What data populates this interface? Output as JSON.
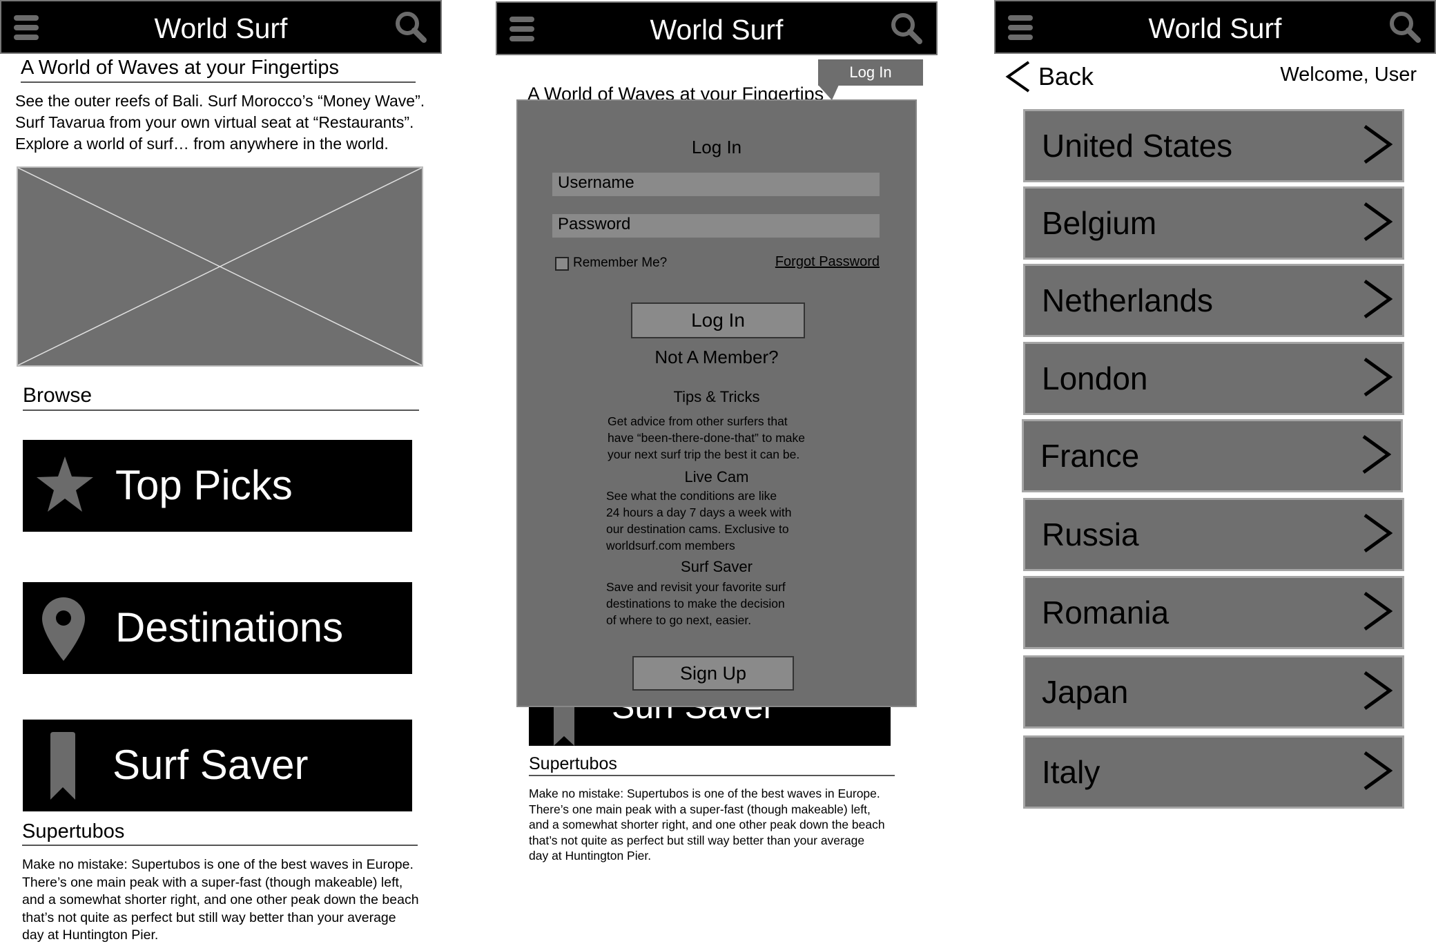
{
  "screens": {
    "home": {
      "app_title": "World Surf",
      "tagline": "A World of Waves at your Fingertips",
      "intro": [
        "See the outer reefs of Bali. Surf Morocco’s “Money Wave”.",
        "Surf Tavarua from your own virtual seat at “Restaurants”.",
        "Explore a world of surf… from anywhere in the world."
      ],
      "browse_label": "Browse",
      "buttons": {
        "top_picks": "Top Picks",
        "destinations": "Destinations",
        "surf_saver": "Surf Saver"
      },
      "article_title": "Supertubos",
      "article_lines": [
        "Make no mistake: Supertubos is one of the best waves in Europe.",
        "There’s one main peak with a super-fast (though makeable) left,",
        "and a somewhat shorter right, and one other peak down the beach",
        "that’s not quite as perfect but still way better than your average",
        "day at Huntington Pier."
      ]
    },
    "login": {
      "app_title": "World Surf",
      "tab_login": "Log In",
      "tagline": "A World of Waves at your Fingertips",
      "modal_title": "Log In",
      "username_placeholder": "Username",
      "password_placeholder": "Password",
      "remember_me": "Remember Me?",
      "forgot_password": "Forgot Password",
      "login_button": "Log In",
      "not_member": "Not A Member?",
      "features": [
        {
          "title": "Tips & Tricks",
          "lines": [
            "Get advice from other surfers that",
            "have “been-there-done-that” to make",
            "your next surf trip the best it can be."
          ]
        },
        {
          "title": "Live Cam",
          "lines": [
            "See what the conditions are like",
            "24 hours a day 7 days a week with",
            "our destination cams. Exclusive to",
            "worldsurf.com members"
          ]
        },
        {
          "title": "Surf Saver",
          "lines": [
            "Save and revisit your favorite surf",
            "destinations to make the decision",
            "of where to go next, easier."
          ]
        }
      ],
      "signup_button": "Sign Up",
      "behind_button": "Surf Saver",
      "article_title": "Supertubos",
      "article_lines": [
        "Make no mistake: Supertubos is one of the best waves in Europe.",
        "There’s one main peak with a super-fast (though makeable) left,",
        "and a somewhat shorter right, and one other peak down the beach",
        "that’s not quite as perfect but still way better than your average",
        "day at Huntington Pier."
      ]
    },
    "destinations": {
      "app_title": "World Surf",
      "back": "Back",
      "welcome": "Welcome, User",
      "countries": [
        "United States",
        "Belgium",
        "Netherlands",
        "London",
        "France",
        "Russia",
        "Romania",
        "Japan",
        "Italy"
      ]
    }
  }
}
